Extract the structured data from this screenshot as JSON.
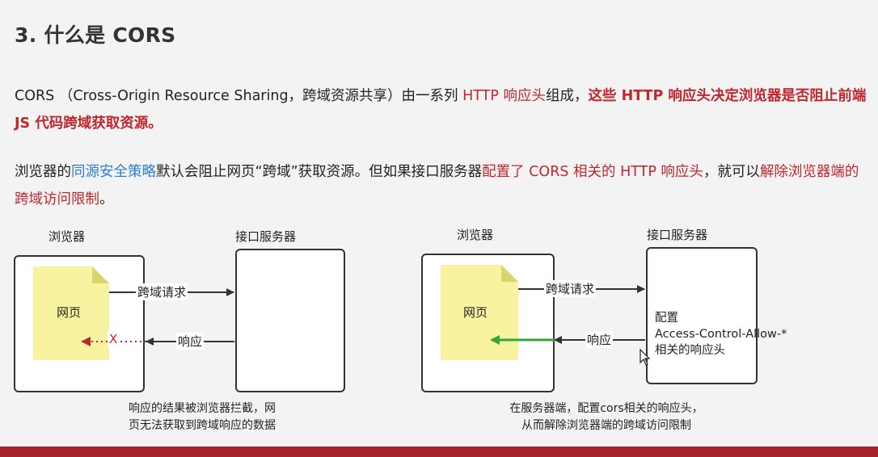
{
  "title": "3. 什么是 CORS",
  "para1": {
    "part1": "CORS （Cross-Origin Resource Sharing，跨域资源共享）由一系列 ",
    "red1": "HTTP 响应头",
    "part2": "组成，",
    "bold_red": "这些 HTTP 响应头决定浏览器是否阻止前端 JS 代码跨域获取资源。"
  },
  "para2": {
    "part1": "浏览器的",
    "blue1": "同源安全策略",
    "part2": "默认会阻止网页“跨域”获取资源。但如果接口服务器",
    "red1": "配置了 CORS 相关的 HTTP 响应头",
    "part3": "，就可以",
    "red2": "解除浏览器端的跨域访问限制",
    "part4": "。"
  },
  "diagram_left": {
    "browser_label": "浏览器",
    "server_label": "接口服务器",
    "page_label": "网页",
    "request_label": "跨域请求",
    "response_label": "响应",
    "blocked_mark": "X",
    "caption_line1": "响应的结果被浏览器拦截，网",
    "caption_line2": "页无法获取到跨域响应的数据"
  },
  "diagram_right": {
    "browser_label": "浏览器",
    "server_label": "接口服务器",
    "page_label": "网页",
    "request_label": "跨域请求",
    "response_label": "响应",
    "server_line1": "配置",
    "server_line2": "Access-Control-Allow-*",
    "server_line3": "相关的响应头",
    "caption_line1": "在服务器端，配置cors相关的响应头，",
    "caption_line2": "从而解除浏览器端的跨域访问限制"
  },
  "colors": {
    "accent_red": "#c0272d",
    "link_blue": "#2a7fd4",
    "note_yellow": "#f7f3a0",
    "allowed_green": "#3aa537",
    "bottom_bar": "#a8242a"
  }
}
